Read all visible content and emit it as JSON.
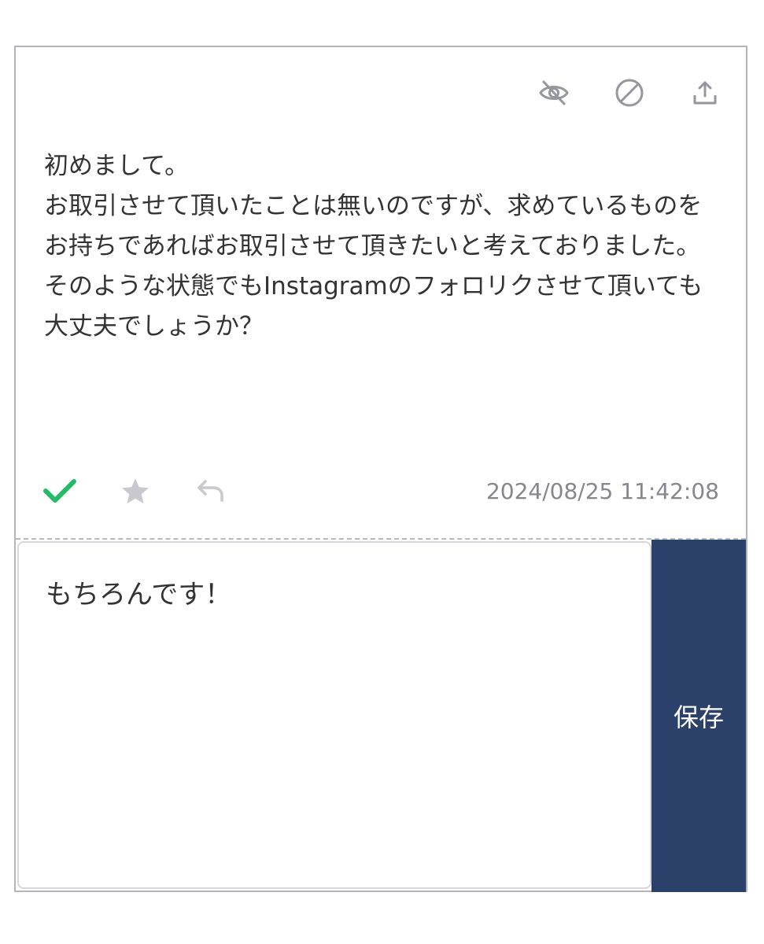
{
  "colors": {
    "icon_gray": "#96969e",
    "check_green": "#22bb66",
    "muted_icon": "#c8c8ce",
    "save_bg": "#2b4169"
  },
  "top_actions": {
    "hide_icon": "eye-slash-icon",
    "block_icon": "ban-icon",
    "share_icon": "upload-icon"
  },
  "message": {
    "text": "初めまして。\nお取引させて頂いたことは無いのですが、求めているものをお持ちであればお取引させて頂きたいと考えておりました。\nそのような状態でもInstagramのフォロリクさせて頂いても大丈夫でしょうか？"
  },
  "bottom_actions": {
    "check_icon": "check-icon",
    "star_icon": "star-icon",
    "reply_icon": "reply-icon"
  },
  "timestamp": "2024/08/25 11:42:08",
  "reply": {
    "value": "もちろんです！"
  },
  "save_button": {
    "label": "保存"
  }
}
